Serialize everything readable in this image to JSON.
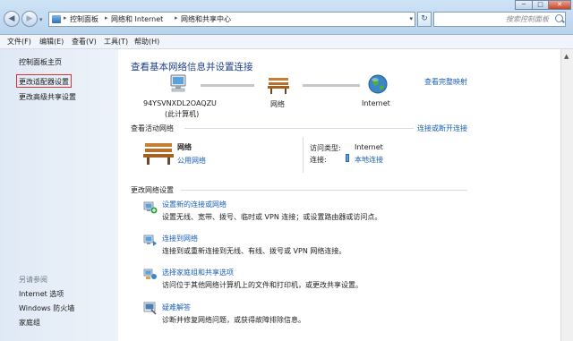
{
  "window": {
    "breadcrumb": [
      "控制面板",
      "网络和 Internet",
      "网络和共享中心"
    ],
    "search_placeholder": "搜索控制面板"
  },
  "menu": [
    "文件(F)",
    "编辑(E)",
    "查看(V)",
    "工具(T)",
    "帮助(H)"
  ],
  "sidebar": {
    "items": [
      "控制面板主页",
      "更改适配器设置",
      "更改高级共享设置"
    ],
    "see_also_header": "另请参阅",
    "see_also": [
      "Internet 选项",
      "Windows 防火墙",
      "家庭组"
    ]
  },
  "main": {
    "title": "查看基本网络信息并设置连接",
    "view_full_map": "查看完整映射",
    "map": {
      "computer_name": "94YSVNXDL2OAQZU",
      "computer_sub": "(此计算机)",
      "network_label": "网络",
      "internet_label": "Internet"
    },
    "active_header": "查看活动网络",
    "connect_disconnect": "连接或断开连接",
    "active_network": {
      "name": "网络",
      "type": "公用网络",
      "access_type_label": "访问类型:",
      "access_type_value": "Internet",
      "connection_label": "连接:",
      "connection_value": "本地连接"
    },
    "change_header": "更改网络设置",
    "tasks": [
      {
        "title": "设置新的连接或网络",
        "desc": "设置无线、宽带、拨号、临时或 VPN 连接；或设置路由器或访问点。"
      },
      {
        "title": "连接到网络",
        "desc": "连接到或重新连接到无线、有线、拨号或 VPN 网络连接。"
      },
      {
        "title": "选择家庭组和共享选项",
        "desc": "访问位于其他网络计算机上的文件和打印机，或更改共享设置。"
      },
      {
        "title": "疑难解答",
        "desc": "诊断并修复网络问题，或获得故障排除信息。"
      }
    ]
  },
  "colors": {
    "title_blue": "#1e3f8a",
    "link_blue": "#1a5fb4",
    "highlight_red": "#dd3333"
  }
}
